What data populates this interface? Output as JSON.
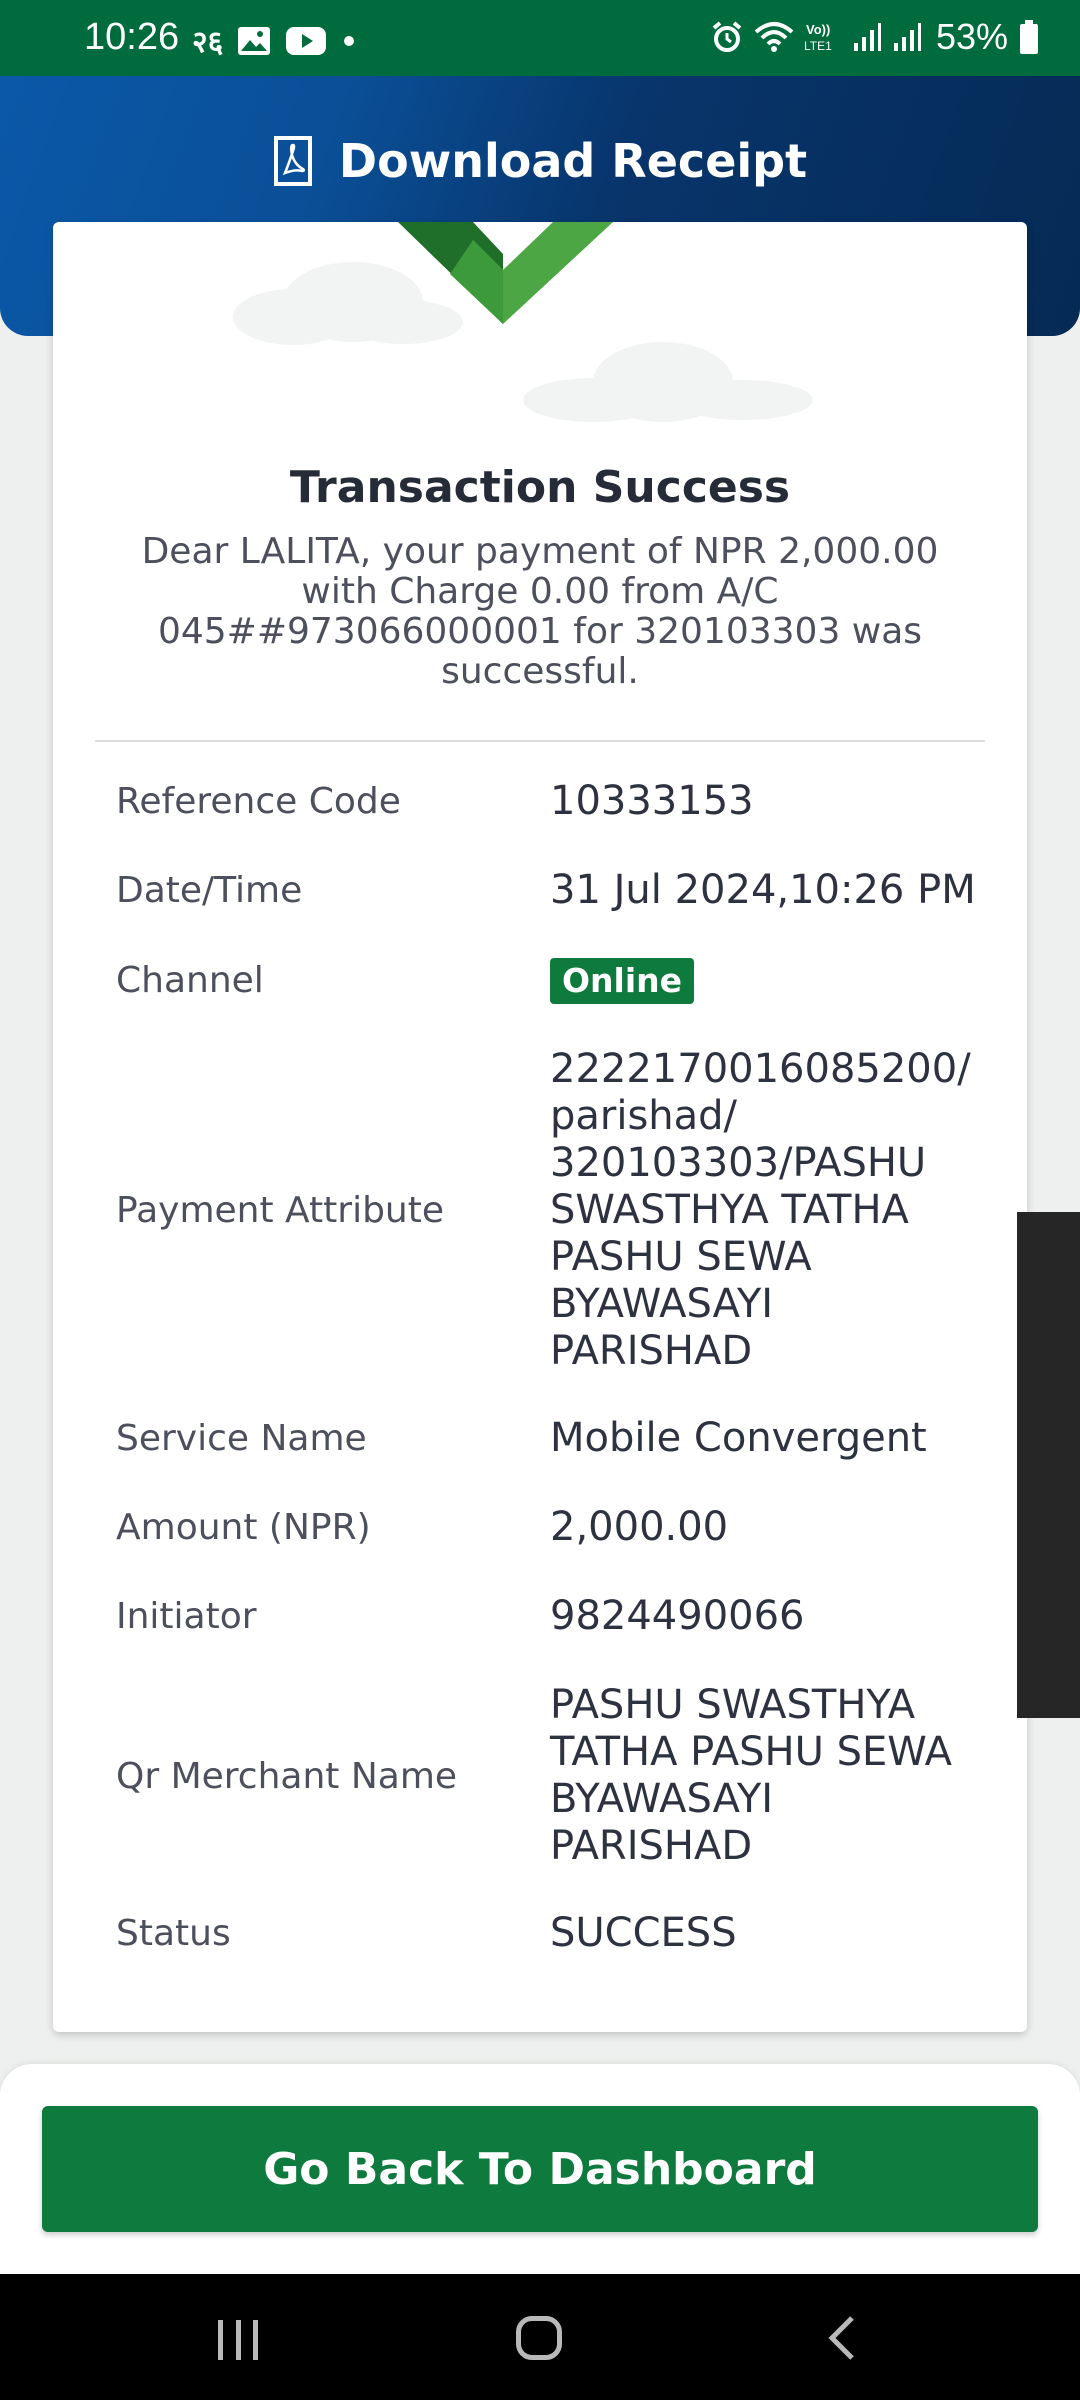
{
  "status_bar": {
    "time": "10:26",
    "ne_icon": "२६",
    "battery": "53%"
  },
  "header": {
    "title": "Download Receipt",
    "icon": "pdf-icon",
    "gradient_start": "#0b58a8",
    "gradient_end": "#052a54"
  },
  "receipt": {
    "title": "Transaction Success",
    "message": "Dear LALITA, your payment of NPR 2,000.00 with Charge 0.00 from A/C 045##973066000001 for 320103303 was successful.",
    "rows": [
      {
        "label": "Reference Code",
        "value": "10333153"
      },
      {
        "label": "Date/Time",
        "value": "31 Jul 2024,10:26 PM"
      },
      {
        "label": "Channel",
        "value": "Online"
      },
      {
        "label": "Payment Attribute",
        "value": [
          "2222170016085200/",
          "parishad/",
          "320103303/PASHU",
          "SWASTHYA TATHA",
          "PASHU SEWA",
          "BYAWASAYI",
          "PARISHAD"
        ]
      },
      {
        "label": "Service Name",
        "value": "Mobile Convergent"
      },
      {
        "label": "Amount (NPR)",
        "value": "2,000.00"
      },
      {
        "label": "Initiator",
        "value": "9824490066"
      },
      {
        "label": "Qr Merchant Name",
        "value": [
          "PASHU SWASTHYA",
          "TATHA PASHU SEWA",
          "BYAWASAYI",
          "PARISHAD"
        ]
      },
      {
        "label": "Status",
        "value": "SUCCESS"
      }
    ]
  },
  "actions": {
    "dashboard_label": "Go Back To Dashboard"
  },
  "colors": {
    "brand_green": "#0e7a3d",
    "status_bar_green": "#006b3c",
    "check_light": "#4ca644",
    "check_dark": "#1f6e2a"
  }
}
